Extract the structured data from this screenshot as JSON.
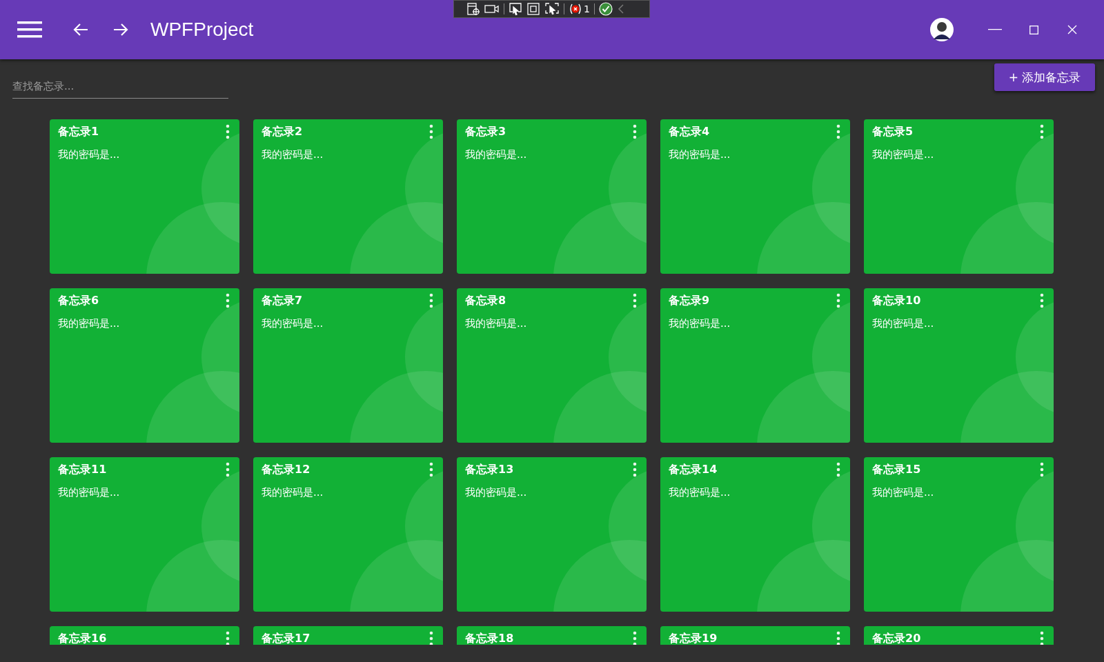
{
  "window": {
    "title": "WPFProject"
  },
  "debug_toolbar": {
    "error_count": "1"
  },
  "search": {
    "placeholder": "查找备忘录..."
  },
  "add_button": {
    "label": "+ 添加备忘录"
  },
  "notes": [
    {
      "title": "备忘录1",
      "body": "我的密码是..."
    },
    {
      "title": "备忘录2",
      "body": "我的密码是..."
    },
    {
      "title": "备忘录3",
      "body": "我的密码是..."
    },
    {
      "title": "备忘录4",
      "body": "我的密码是..."
    },
    {
      "title": "备忘录5",
      "body": "我的密码是..."
    },
    {
      "title": "备忘录6",
      "body": "我的密码是..."
    },
    {
      "title": "备忘录7",
      "body": "我的密码是..."
    },
    {
      "title": "备忘录8",
      "body": "我的密码是..."
    },
    {
      "title": "备忘录9",
      "body": "我的密码是..."
    },
    {
      "title": "备忘录10",
      "body": "我的密码是..."
    },
    {
      "title": "备忘录11",
      "body": "我的密码是..."
    },
    {
      "title": "备忘录12",
      "body": "我的密码是..."
    },
    {
      "title": "备忘录13",
      "body": "我的密码是..."
    },
    {
      "title": "备忘录14",
      "body": "我的密码是..."
    },
    {
      "title": "备忘录15",
      "body": "我的密码是..."
    },
    {
      "title": "备忘录16"
    },
    {
      "title": "备忘录17"
    },
    {
      "title": "备忘录18"
    },
    {
      "title": "备忘录19"
    },
    {
      "title": "备忘录20"
    }
  ]
}
